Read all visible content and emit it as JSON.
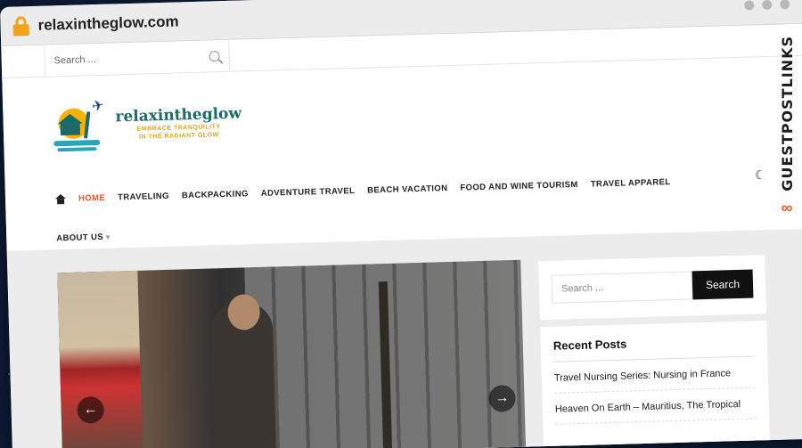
{
  "browser": {
    "url": "relaxintheglow.com"
  },
  "header": {
    "search_placeholder": "Search ...",
    "logo": {
      "name": "relaxintheglow",
      "tagline_line1": "EMBRACE TRANQUILITY",
      "tagline_line2": "IN THE RADIANT GLOW"
    }
  },
  "nav": {
    "items": [
      "HOME",
      "TRAVELING",
      "BACKPACKING",
      "ADVENTURE TRAVEL",
      "BEACH VACATION",
      "FOOD AND WINE TOURISM",
      "TRAVEL APPAREL"
    ],
    "second_row": "ABOUT US"
  },
  "sidebar": {
    "search_placeholder": "Search ...",
    "search_button": "Search",
    "recent_title": "Recent Posts",
    "recent_posts": [
      "Travel Nursing Series: Nursing in France",
      "Heaven On Earth – Mauritius, The Tropical"
    ]
  },
  "badge": {
    "text": "GUESTPOSTLINKS"
  },
  "colors": {
    "accent": "#e05a2b",
    "brand": "#1c6b6b",
    "badge": "#ef5a2a"
  }
}
